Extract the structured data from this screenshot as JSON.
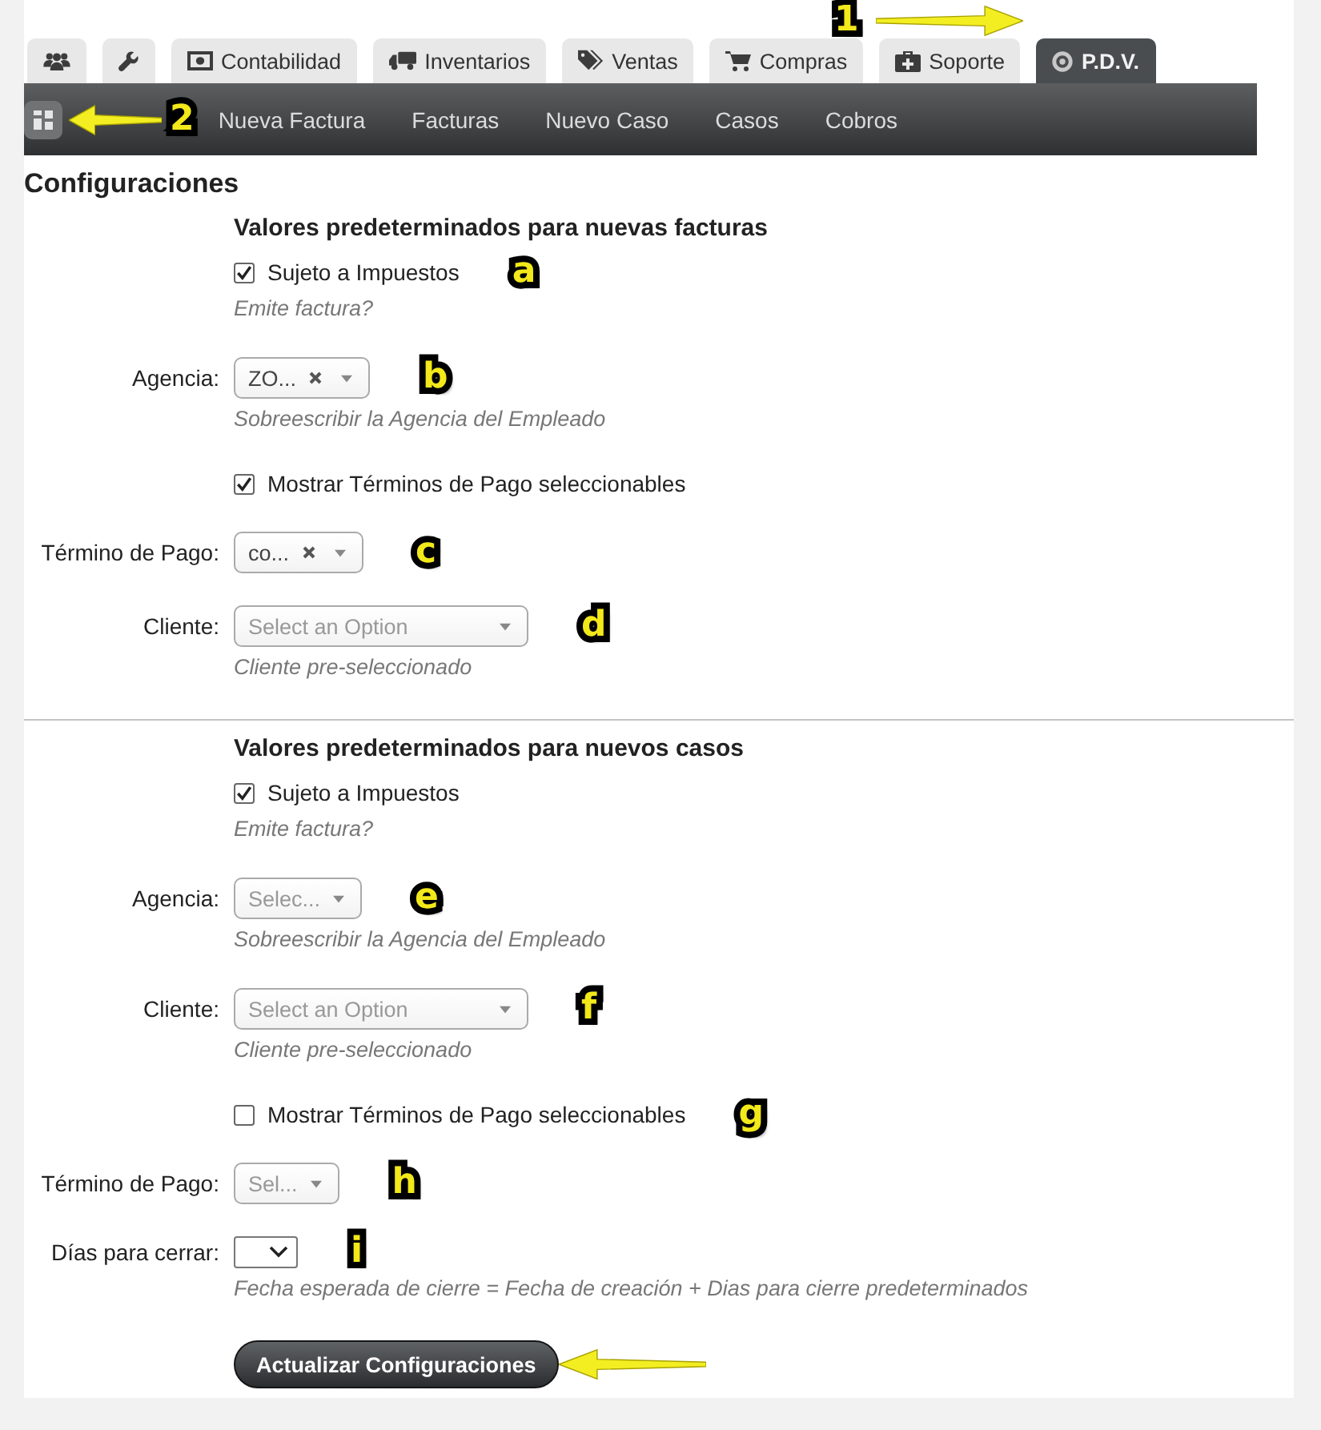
{
  "tab_bar": {
    "callout": "1",
    "tabs": [
      {
        "selected": false
      },
      {
        "selected": false
      },
      {
        "label": "Contabilidad",
        "selected": false
      },
      {
        "label": "Inventarios",
        "selected": false
      },
      {
        "label": "Ventas",
        "selected": false
      },
      {
        "label": "Compras",
        "selected": false
      },
      {
        "label": "Soporte",
        "selected": false
      },
      {
        "label": "P.D.V.",
        "selected": true
      }
    ]
  },
  "nav_bar": {
    "callout": "2",
    "items": [
      {
        "label": "Nueva Factura"
      },
      {
        "label": "Facturas"
      },
      {
        "label": "Nuevo Caso"
      },
      {
        "label": "Casos"
      },
      {
        "label": "Cobros"
      }
    ]
  },
  "title": "Configuraciones",
  "sections": [
    {
      "heading": "Valores predeterminados para nuevas facturas",
      "rows": [
        {
          "kind": "checkbox",
          "label": "Sujeto a Impuestos",
          "checked": true,
          "hint": "Emite factura?",
          "callout": "a"
        },
        {
          "kind": "select",
          "label": "Agencia:",
          "value": "ZO...",
          "hint": "Sobreescribir la Agencia del Empleado",
          "callout": "b"
        },
        {
          "kind": "checkbox",
          "label": "Mostrar Términos de Pago seleccionables",
          "checked": true
        },
        {
          "kind": "select",
          "label": "Término de Pago:",
          "value": "co...",
          "callout": "c"
        },
        {
          "kind": "select",
          "label": "Cliente:",
          "placeholder": "Select an Option",
          "hint": "Cliente pre-seleccionado",
          "callout": "d"
        }
      ]
    },
    {
      "heading": "Valores predeterminados para nuevos casos",
      "rows": [
        {
          "kind": "checkbox",
          "label": "Sujeto a Impuestos",
          "checked": true,
          "hint": "Emite factura?"
        },
        {
          "kind": "select",
          "label": "Agencia:",
          "placeholder": "Selec...",
          "hint": "Sobreescribir la Agencia del Empleado",
          "callout": "e"
        },
        {
          "kind": "select",
          "label": "Cliente:",
          "placeholder": "Select an Option",
          "hint": "Cliente pre-seleccionado",
          "callout": "f"
        },
        {
          "kind": "checkbox",
          "label": "Mostrar Términos de Pago seleccionables",
          "checked": false,
          "callout": "g"
        },
        {
          "kind": "select",
          "label": "Término de Pago:",
          "placeholder": "Sel...",
          "callout": "h"
        },
        {
          "kind": "native-select",
          "label": "Días para cerrar:",
          "hint": "Fecha esperada de cierre = Fecha de creación + Dias para cierre predeterminados",
          "callout": "i"
        }
      ]
    }
  ],
  "submit": {
    "label": "Actualizar Configuraciones",
    "arrow": true
  }
}
